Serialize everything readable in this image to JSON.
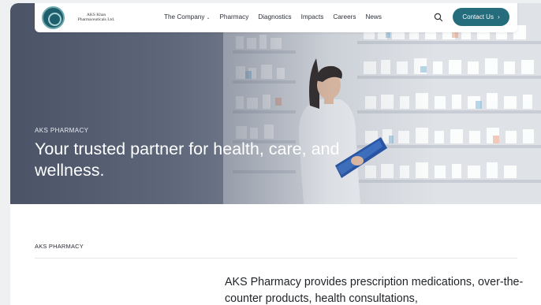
{
  "brand": {
    "logo_line1": "AKS Khan",
    "logo_line2": "Pharmaceuticals Ltd."
  },
  "nav": {
    "items": [
      {
        "label": "The Company",
        "has_dropdown": true
      },
      {
        "label": "Pharmacy"
      },
      {
        "label": "Diagnostics"
      },
      {
        "label": "Impacts"
      },
      {
        "label": "Careers"
      },
      {
        "label": "News"
      }
    ],
    "search_icon": "search-icon",
    "cta_label": "Contact Us",
    "cta_icon": "chevron-right-icon"
  },
  "hero": {
    "kicker": "AKS PHARMACY",
    "title": "Your trusted partner for health, care, and wellness."
  },
  "section": {
    "kicker": "AKS PHARMACY",
    "intro": "AKS Pharmacy provides prescription medications, over-the-counter products, health consultations,"
  },
  "colors": {
    "accent": "#256c7c",
    "text_dark": "#1f2328"
  }
}
